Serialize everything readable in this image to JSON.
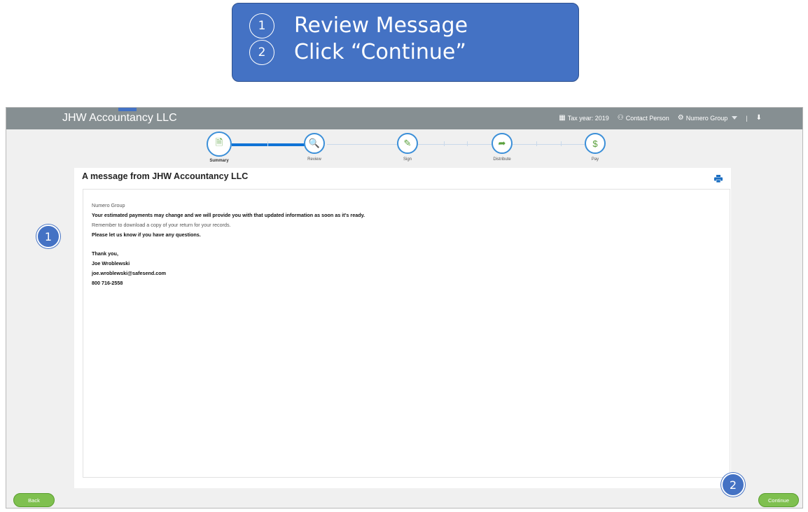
{
  "callout": {
    "steps": [
      {
        "num": "1",
        "text": "Review Message"
      },
      {
        "num": "2",
        "text": "Click “Continue”"
      }
    ]
  },
  "header": {
    "brand": "JHW Accountancy LLC",
    "tax_year": "Tax year: 2019",
    "contact": "Contact Person",
    "group": "Numero Group",
    "separator": "|"
  },
  "stepper": {
    "steps": [
      {
        "label": "Summary",
        "icon": "summary-document-icon",
        "state": "active"
      },
      {
        "label": "Review",
        "icon": "review-search-icon",
        "state": "pending"
      },
      {
        "label": "Sign",
        "icon": "sign-pen-icon",
        "state": "pending"
      },
      {
        "label": "Distribute",
        "icon": "distribute-share-icon",
        "state": "pending"
      },
      {
        "label": "Pay",
        "icon": "pay-dollar-icon",
        "state": "pending"
      }
    ],
    "active_color": "#0f73d6"
  },
  "panel": {
    "title": "A message from JHW Accountancy LLC",
    "message": {
      "greeting": "Numero Group",
      "line1": "Your estimated payments may change and we will provide you with that updated information as soon as it's ready.",
      "line2": "Remember to download a copy of your return for your records.",
      "line3": "Please let us know if you have any questions.",
      "sign_off": "Thank you,",
      "name": "Joe Wroblewski",
      "email": "joe.wroblewski@safesend.com",
      "phone": "800 716-2558"
    }
  },
  "buttons": {
    "back": "Back",
    "continue": "Continue"
  },
  "badges": {
    "b1": "1",
    "b2": "2"
  },
  "colors": {
    "header": "#868f92",
    "button": "#7fc04f",
    "callout": "#4472c4"
  }
}
